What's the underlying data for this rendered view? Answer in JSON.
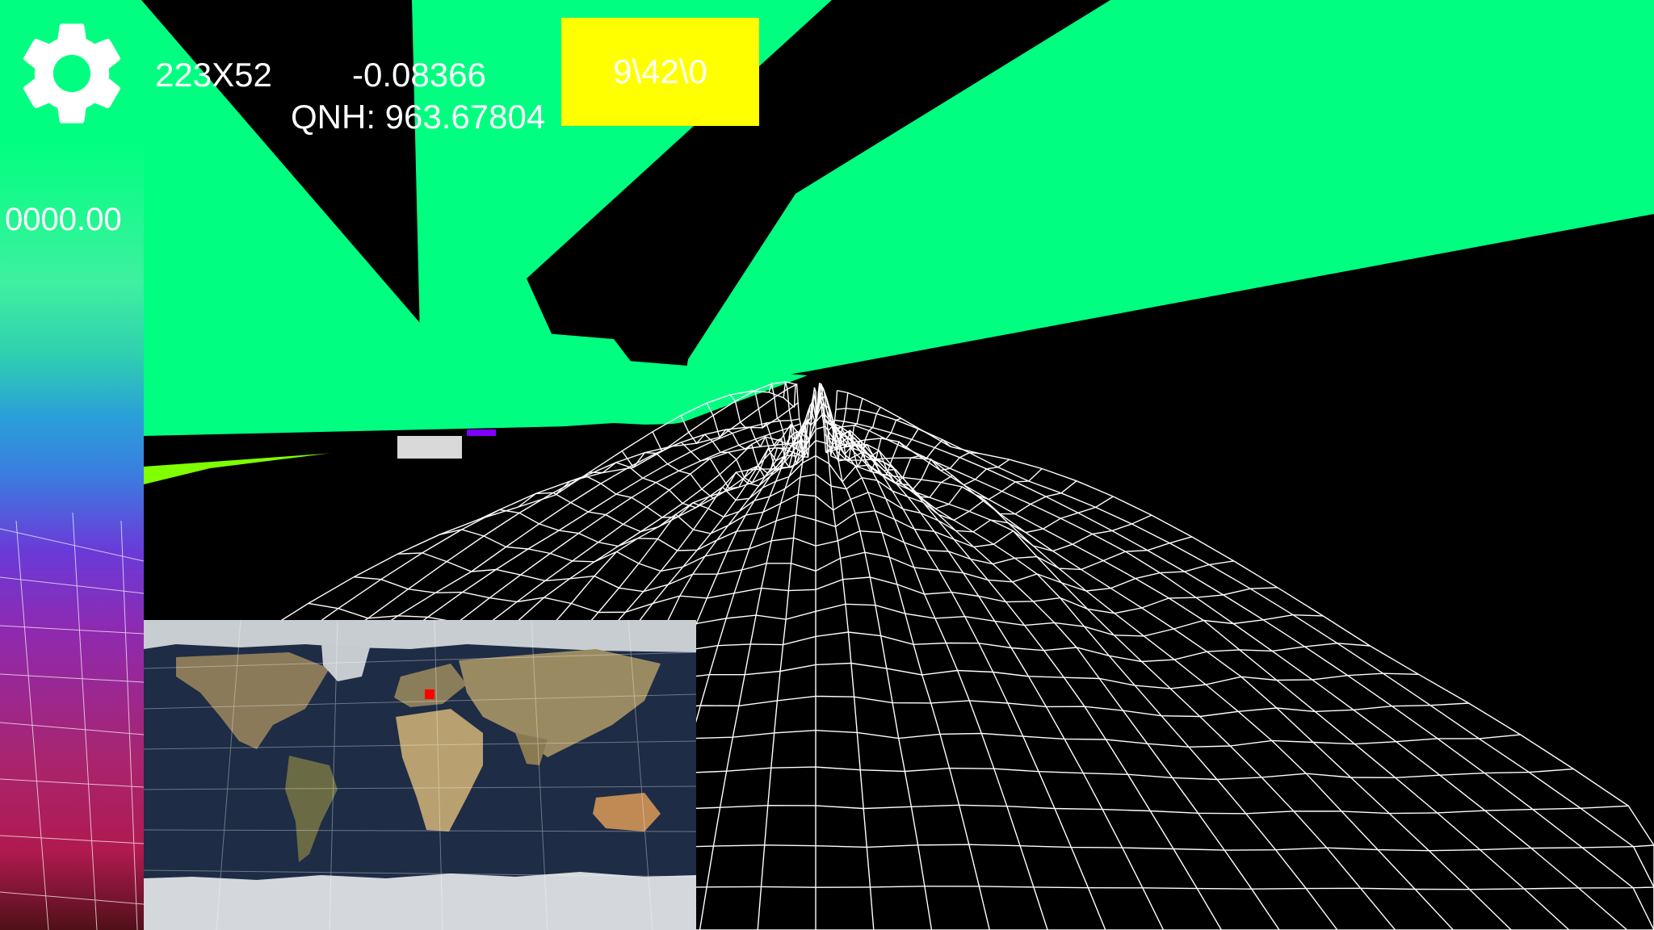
{
  "hud": {
    "grid_size": "223X52",
    "vertical_speed": "-0.08366",
    "qnh_label": "QNH:",
    "qnh_value": "963.67804",
    "time": "9\\42\\0",
    "altitude": "0000.00"
  },
  "icons": {
    "settings": "gear-icon"
  },
  "colors": {
    "sky_green": "#00ff80",
    "terrain_black": "#000000",
    "wireframe": "#ffffff",
    "time_box": "#ffff00",
    "position_marker": "#ff0000",
    "ground_lime": "#80ff00"
  }
}
